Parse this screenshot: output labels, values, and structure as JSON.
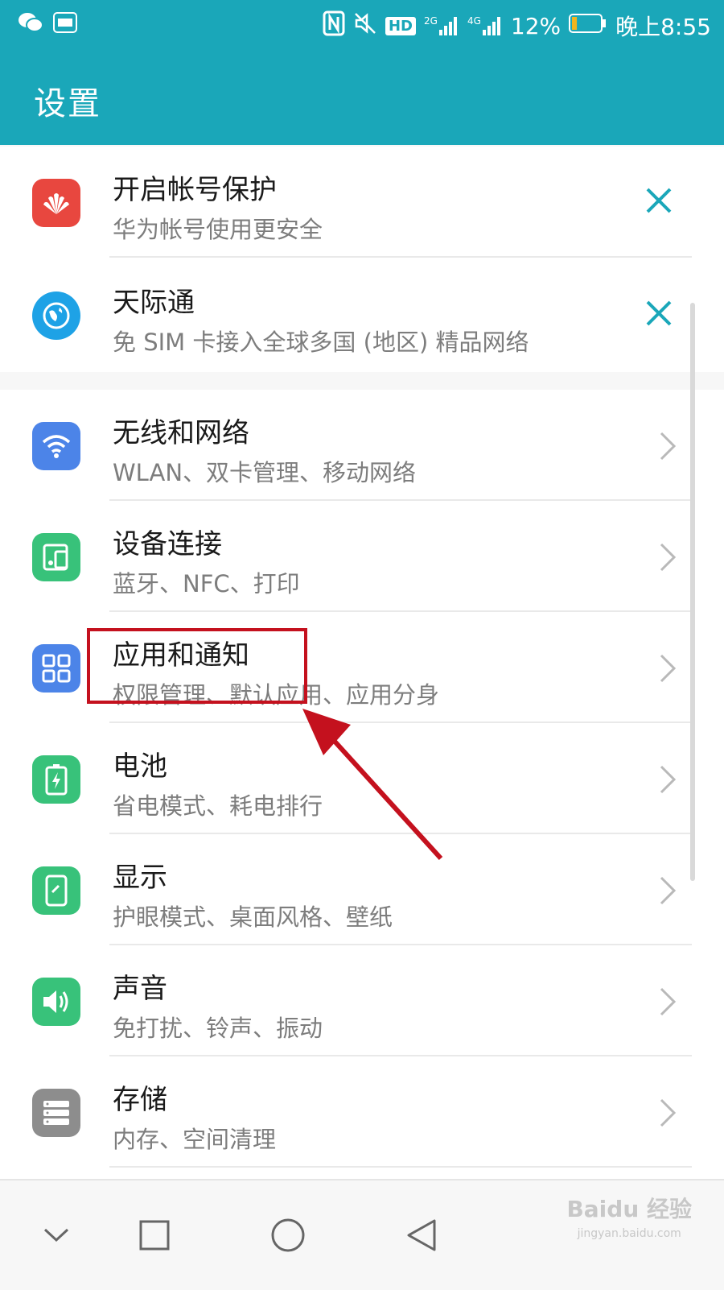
{
  "status_bar": {
    "network_2g": "2G",
    "network_4g": "4G",
    "hd_label": "HD",
    "battery_percent": "12%",
    "time": "晚上8:55",
    "battery_level": 0.12
  },
  "header": {
    "title": "设置"
  },
  "promo_items": [
    {
      "icon": "huawei-logo-icon",
      "label": "开启帐号保护",
      "sub": "华为帐号使用更安全",
      "color": "#e8473f"
    },
    {
      "icon": "globe-icon",
      "label": "天际通",
      "sub": "免 SIM 卡接入全球多国 (地区) 精品网络",
      "color": "#1ea2e6"
    }
  ],
  "settings_items": [
    {
      "icon": "wifi-icon",
      "label": "无线和网络",
      "sub": "WLAN、双卡管理、移动网络",
      "color": "#4c84e8"
    },
    {
      "icon": "device-connection-icon",
      "label": "设备连接",
      "sub": "蓝牙、NFC、打印",
      "color": "#38c27a"
    },
    {
      "icon": "apps-grid-icon",
      "label": "应用和通知",
      "sub": "权限管理、默认应用、应用分身",
      "color": "#4c84e8"
    },
    {
      "icon": "battery-icon",
      "label": "电池",
      "sub": "省电模式、耗电排行",
      "color": "#38c27a"
    },
    {
      "icon": "display-icon",
      "label": "显示",
      "sub": "护眼模式、桌面风格、壁纸",
      "color": "#38c27a"
    },
    {
      "icon": "speaker-icon",
      "label": "声音",
      "sub": "免打扰、铃声、振动",
      "color": "#38c27a"
    },
    {
      "icon": "storage-icon",
      "label": "存储",
      "sub": "内存、空间清理",
      "color": "#8d8d8d"
    }
  ],
  "annotation": {
    "highlight_color": "#c4111e"
  },
  "watermark": {
    "brand": "Baidu 经验",
    "url": "jingyan.baidu.com"
  }
}
